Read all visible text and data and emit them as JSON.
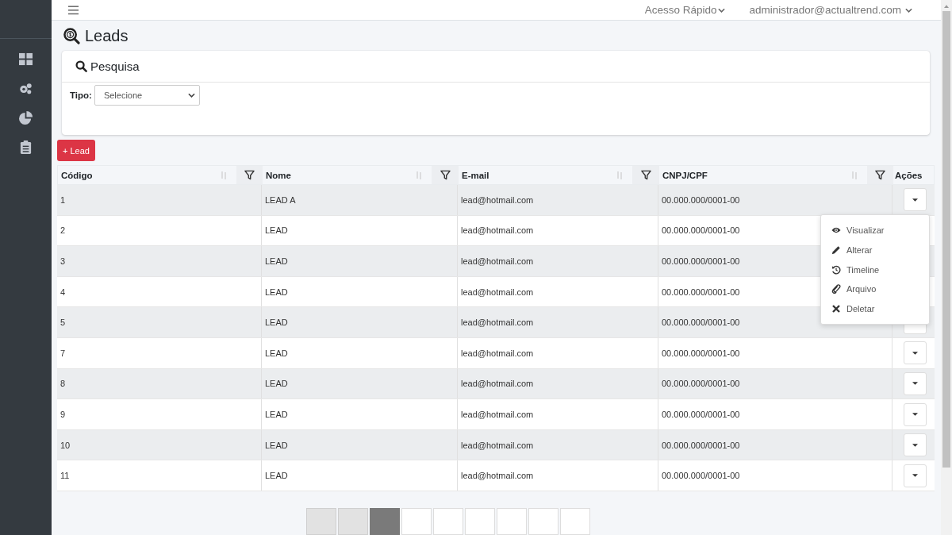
{
  "topbar": {
    "menu_label": "Acesso Rápido",
    "user": "administrador@actualtrend.com"
  },
  "page_title": "Leads",
  "search_card": {
    "title": "Pesquisa",
    "type_label": "Tipo:",
    "type_value": "Selecione"
  },
  "add_button": "+ Lead",
  "table": {
    "columns": [
      "Código",
      "Nome",
      "E-mail",
      "CNPJ/CPF",
      "Ações"
    ],
    "rows": [
      {
        "code": "1",
        "name": "LEAD A",
        "email": "lead@hotmail.com",
        "doc": "00.000.000/0001-00"
      },
      {
        "code": "2",
        "name": "LEAD",
        "email": "lead@hotmail.com",
        "doc": "00.000.000/0001-00"
      },
      {
        "code": "3",
        "name": "LEAD",
        "email": "lead@hotmail.com",
        "doc": "00.000.000/0001-00"
      },
      {
        "code": "4",
        "name": "LEAD",
        "email": "lead@hotmail.com",
        "doc": "00.000.000/0001-00"
      },
      {
        "code": "5",
        "name": "LEAD",
        "email": "lead@hotmail.com",
        "doc": "00.000.000/0001-00"
      },
      {
        "code": "7",
        "name": "LEAD",
        "email": "lead@hotmail.com",
        "doc": "00.000.000/0001-00"
      },
      {
        "code": "8",
        "name": "LEAD",
        "email": "lead@hotmail.com",
        "doc": "00.000.000/0001-00"
      },
      {
        "code": "9",
        "name": "LEAD",
        "email": "lead@hotmail.com",
        "doc": "00.000.000/0001-00"
      },
      {
        "code": "10",
        "name": "LEAD",
        "email": "lead@hotmail.com",
        "doc": "00.000.000/0001-00"
      },
      {
        "code": "11",
        "name": "LEAD",
        "email": "lead@hotmail.com",
        "doc": "00.000.000/0001-00"
      }
    ]
  },
  "action_menu": {
    "items": [
      {
        "kind": "view",
        "label": "Visualizar"
      },
      {
        "kind": "edit",
        "label": "Alterar"
      },
      {
        "kind": "history",
        "label": "Timeline"
      },
      {
        "kind": "attach",
        "label": "Arquivo"
      },
      {
        "kind": "delete",
        "label": "Deletar"
      }
    ]
  },
  "pagination": [
    {
      "selected": false,
      "disabled": true
    },
    {
      "selected": false,
      "disabled": true
    },
    {
      "selected": true,
      "disabled": false
    },
    {
      "selected": false,
      "disabled": false
    },
    {
      "selected": false,
      "disabled": false
    },
    {
      "selected": false,
      "disabled": false
    },
    {
      "selected": false,
      "disabled": false
    },
    {
      "selected": false,
      "disabled": false
    },
    {
      "selected": false,
      "disabled": false
    }
  ]
}
